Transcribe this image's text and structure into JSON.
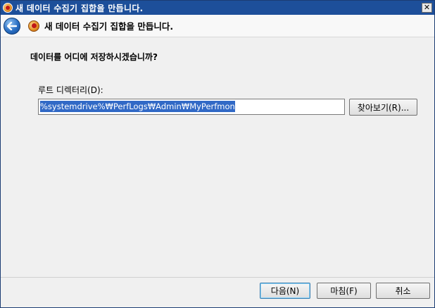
{
  "window": {
    "title": "새 데이터 수집기 집합을 만듭니다.",
    "close_glyph": "✕"
  },
  "header": {
    "heading": "새 데이터 수집기 집합을 만듭니다."
  },
  "main": {
    "question": "데이터를 어디에 저장하시겠습니까?",
    "root_dir_label": "루트 디렉터리(D):",
    "root_dir_value": "%systemdrive%\\PerfLogs\\Admin\\MyPerfmon",
    "root_dir_display": "%systemdrive%₩PerfLogs₩Admin₩MyPerfmon",
    "browse_label": "찾아보기(R)..."
  },
  "footer": {
    "next_label": "다음(N)",
    "finish_label": "마침(F)",
    "cancel_label": "취소"
  },
  "colors": {
    "titlebar": "#1d4f9a",
    "selection": "#3169c6",
    "window_bg": "#f0f0f0"
  },
  "icons": {
    "app": "performance-monitor-icon",
    "back": "back-arrow-icon",
    "wizard": "performance-monitor-icon",
    "close": "close-icon"
  }
}
